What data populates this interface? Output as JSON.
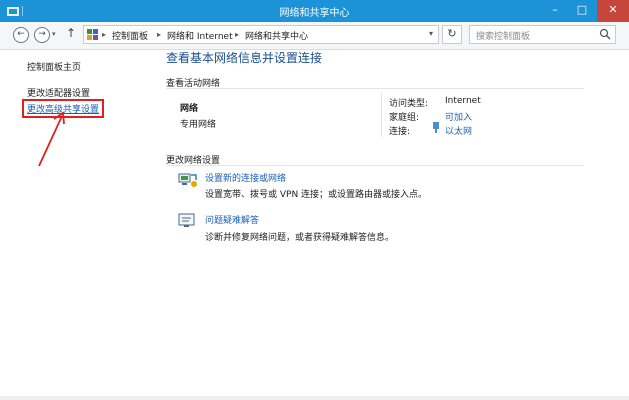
{
  "window": {
    "title": "网络和共享中心",
    "controls": {
      "minimize": "–",
      "maximize": "□",
      "close": "✕"
    }
  },
  "nav": {
    "back": "←",
    "forward": "→",
    "recent": "▾",
    "up": "↑",
    "breadcrumbs": [
      "控制面板",
      "网络和 Internet",
      "网络和共享中心"
    ],
    "separator": "▸",
    "address_dropdown": "▾",
    "refresh": "↻",
    "search_placeholder": "搜索控制面板"
  },
  "sidebar": {
    "home": "控制面板主页",
    "adapter": "更改适配器设置",
    "advanced": "更改高级共享设置"
  },
  "main": {
    "title": "查看基本网络信息并设置连接",
    "active_networks_header": "查看活动网络",
    "network": {
      "name": "网络",
      "category": "专用网络",
      "access_type_label": "访问类型:",
      "access_type_value": "Internet",
      "homegroup_label": "家庭组:",
      "homegroup_value": "可加入",
      "connections_label": "连接:",
      "connections_value": "以太网"
    },
    "change_settings_header": "更改网络设置",
    "tasks": [
      {
        "link": "设置新的连接或网络",
        "desc": "设置宽带、拨号或 VPN 连接；或设置路由器或接入点。"
      },
      {
        "link": "问题疑难解答",
        "desc": "诊断并修复网络问题，或者获得疑难解答信息。"
      }
    ]
  },
  "colors": {
    "titlebar": "#1b93d6",
    "link": "#1a5fb4",
    "heading": "#1a4d8c",
    "highlight": "#e02020"
  }
}
